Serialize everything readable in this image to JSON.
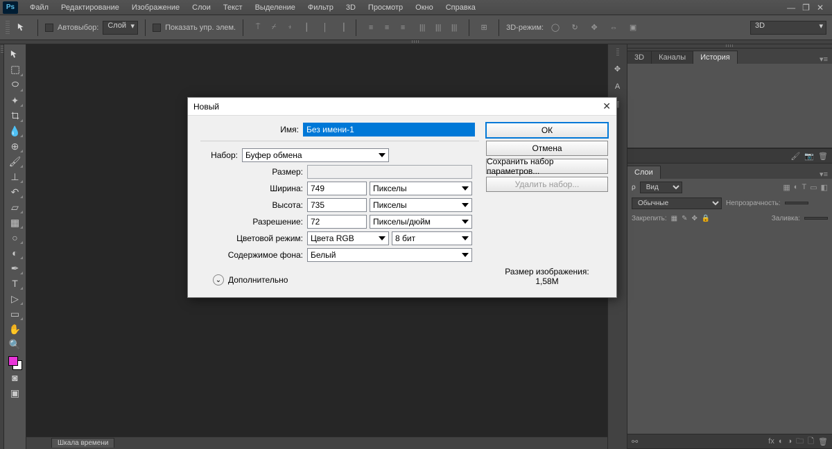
{
  "app": {
    "logo": "Ps"
  },
  "menu": [
    "Файл",
    "Редактирование",
    "Изображение",
    "Слои",
    "Текст",
    "Выделение",
    "Фильтр",
    "3D",
    "Просмотр",
    "Окно",
    "Справка"
  ],
  "optbar": {
    "auto_select": "Автовыбор:",
    "layer_dd": "Слой",
    "show_ctrls": "Показать упр. элем.",
    "mode3d": "3D-режим:",
    "right_dd": "3D"
  },
  "panels": {
    "history_tabs": [
      "3D",
      "Каналы",
      "История"
    ],
    "layers_tab": "Слои",
    "kind": "Вид",
    "blend": "Обычные",
    "opacity_lbl": "Непрозрачность:",
    "lock_lbl": "Закрепить:",
    "fill_lbl": "Заливка:"
  },
  "timeline": {
    "tab": "Шкала времени"
  },
  "dialog": {
    "title": "Новый",
    "name_lbl": "Имя:",
    "name_val": "Без имени-1",
    "preset_lbl": "Набор:",
    "preset_val": "Буфер обмена",
    "size_lbl": "Размер:",
    "width_lbl": "Ширина:",
    "width_val": "749",
    "width_unit": "Пикселы",
    "height_lbl": "Высота:",
    "height_val": "735",
    "height_unit": "Пикселы",
    "res_lbl": "Разрешение:",
    "res_val": "72",
    "res_unit": "Пикселы/дюйм",
    "mode_lbl": "Цветовой режим:",
    "mode_val": "Цвета RGB",
    "bits_val": "8 бит",
    "bg_lbl": "Содержимое фона:",
    "bg_val": "Белый",
    "advanced": "Дополнительно",
    "ok": "ОК",
    "cancel": "Отмена",
    "save_preset": "Сохранить набор параметров...",
    "delete_preset": "Удалить набор...",
    "size_info_lbl": "Размер изображения:",
    "size_info_val": "1,58M"
  }
}
